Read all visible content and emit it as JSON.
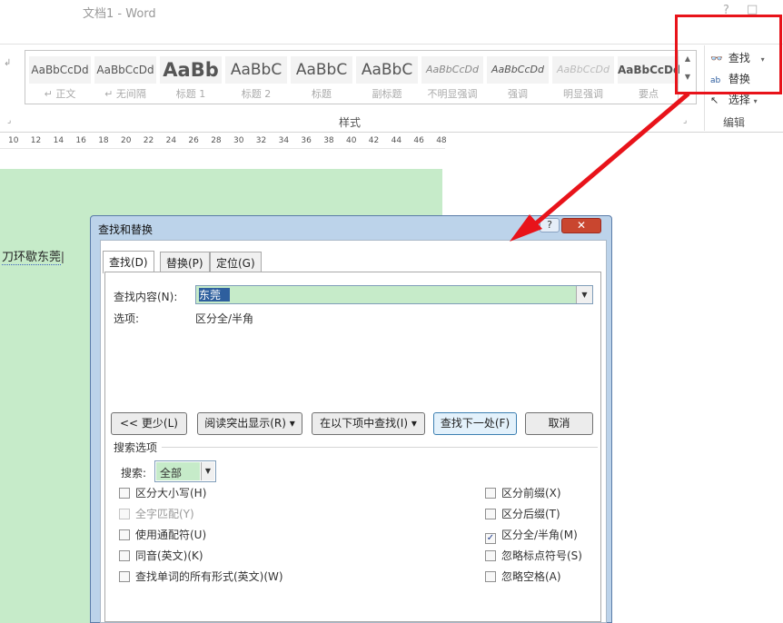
{
  "window": {
    "title": "文档1 - Word",
    "help": "?",
    "restore": "□"
  },
  "styles": {
    "group_label": "样式",
    "items": [
      {
        "preview": "AaBbCcDd",
        "name": "↵ 正文"
      },
      {
        "preview": "AaBbCcDd",
        "name": "↵ 无间隔"
      },
      {
        "preview": "AaBb",
        "name": "标题 1"
      },
      {
        "preview": "AaBbC",
        "name": "标题 2"
      },
      {
        "preview": "AaBbC",
        "name": "标题"
      },
      {
        "preview": "AaBbC",
        "name": "副标题"
      },
      {
        "preview": "AaBbCcDd",
        "name": "不明显强调"
      },
      {
        "preview": "AaBbCcDd",
        "name": "强调"
      },
      {
        "preview": "AaBbCcDd",
        "name": "明显强调"
      },
      {
        "preview": "AaBbCcDd",
        "name": "要点"
      }
    ],
    "scroll_up": "▲",
    "scroll_down": "▼"
  },
  "edit_group": {
    "find": "查找",
    "replace": "替换",
    "select": "选择",
    "label": "编辑",
    "find_icon": "binoculars-icon",
    "replace_icon": "replace-icon",
    "select_icon": "cursor-icon"
  },
  "ruler": {
    "ticks": [
      "10",
      "12",
      "14",
      "16",
      "18",
      "20",
      "22",
      "24",
      "26",
      "28",
      "30",
      "32",
      "34",
      "36",
      "38",
      "40",
      "42",
      "44",
      "46",
      "48"
    ]
  },
  "document": {
    "text": "刀环歇东莞"
  },
  "dialog": {
    "title": "查找和替换",
    "help": "?",
    "close": "✕",
    "tabs": [
      "查找(D)",
      "替换(P)",
      "定位(G)"
    ],
    "find_label": "查找内容(N):",
    "find_value": "东莞",
    "options_label": "选项:",
    "options_value": "区分全/半角",
    "buttons": {
      "less": "<< 更少(L)",
      "reading_highlight": "阅读突出显示(R) ▾",
      "find_in": "在以下项中查找(I) ▾",
      "find_next": "查找下一处(F)",
      "cancel": "取消"
    },
    "search_options_label": "搜索选项",
    "search_label": "搜索:",
    "search_value": "全部",
    "left_options": [
      {
        "label": "区分大小写(H)",
        "checked": false,
        "enabled": true
      },
      {
        "label": "全字匹配(Y)",
        "checked": false,
        "enabled": false
      },
      {
        "label": "使用通配符(U)",
        "checked": false,
        "enabled": true
      },
      {
        "label": "同音(英文)(K)",
        "checked": false,
        "enabled": true
      },
      {
        "label": "查找单词的所有形式(英文)(W)",
        "checked": false,
        "enabled": true
      }
    ],
    "right_options": [
      {
        "label": "区分前缀(X)",
        "checked": false,
        "enabled": true
      },
      {
        "label": "区分后缀(T)",
        "checked": false,
        "enabled": true
      },
      {
        "label": "区分全/半角(M)",
        "checked": true,
        "enabled": true
      },
      {
        "label": "忽略标点符号(S)",
        "checked": false,
        "enabled": true
      },
      {
        "label": "忽略空格(A)",
        "checked": false,
        "enabled": true
      }
    ]
  },
  "colors": {
    "highlight_red": "#e8131a",
    "page_green": "#c6ebc9",
    "dialog_frame": "#bcd3ea",
    "selection_blue": "#2e5f9e"
  }
}
